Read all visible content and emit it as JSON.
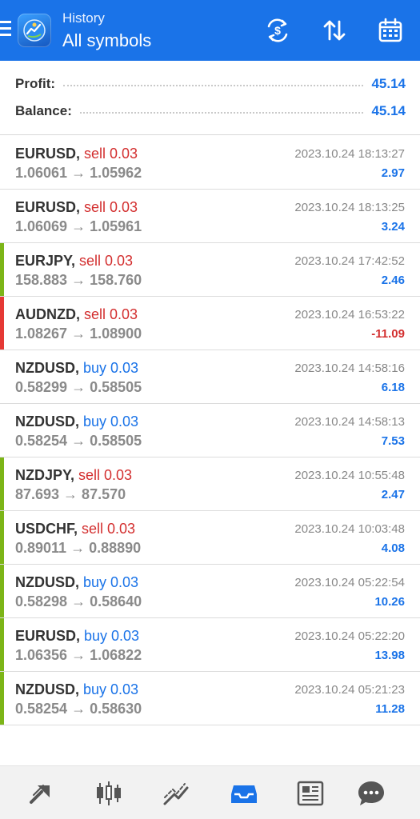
{
  "header": {
    "title_small": "History",
    "title_big": "All symbols",
    "icons": [
      "menu-icon",
      "app-logo",
      "currency-exchange-icon",
      "sort-icon",
      "calendar-icon"
    ]
  },
  "summary": {
    "profit_label": "Profit:",
    "profit_value": "45.14",
    "balance_label": "Balance:",
    "balance_value": "45.14"
  },
  "deals": [
    {
      "symbol": "EURUSD,",
      "side": "sell 0.03",
      "type": "sell",
      "prices": "1.06061 → 1.05962",
      "time": "2023.10.24 18:13:27",
      "profit": "2.97",
      "bar": ""
    },
    {
      "symbol": "EURUSD,",
      "side": "sell 0.03",
      "type": "sell",
      "prices": "1.06069 → 1.05961",
      "time": "2023.10.24 18:13:25",
      "profit": "3.24",
      "bar": ""
    },
    {
      "symbol": "EURJPY,",
      "side": "sell 0.03",
      "type": "sell",
      "prices": "158.883 → 158.760",
      "time": "2023.10.24 17:42:52",
      "profit": "2.46",
      "bar": "#7cb518"
    },
    {
      "symbol": "AUDNZD,",
      "side": "sell 0.03",
      "type": "sell",
      "prices": "1.08267 → 1.08900",
      "time": "2023.10.24 16:53:22",
      "profit": "-11.09",
      "bar": "#e53935"
    },
    {
      "symbol": "NZDUSD,",
      "side": "buy 0.03",
      "type": "buy",
      "prices": "0.58299 → 0.58505",
      "time": "2023.10.24 14:58:16",
      "profit": "6.18",
      "bar": ""
    },
    {
      "symbol": "NZDUSD,",
      "side": "buy 0.03",
      "type": "buy",
      "prices": "0.58254 → 0.58505",
      "time": "2023.10.24 14:58:13",
      "profit": "7.53",
      "bar": ""
    },
    {
      "symbol": "NZDJPY,",
      "side": "sell 0.03",
      "type": "sell",
      "prices": "87.693 → 87.570",
      "time": "2023.10.24 10:55:48",
      "profit": "2.47",
      "bar": "#7cb518"
    },
    {
      "symbol": "USDCHF,",
      "side": "sell 0.03",
      "type": "sell",
      "prices": "0.89011 → 0.88890",
      "time": "2023.10.24 10:03:48",
      "profit": "4.08",
      "bar": "#7cb518"
    },
    {
      "symbol": "NZDUSD,",
      "side": "buy 0.03",
      "type": "buy",
      "prices": "0.58298 → 0.58640",
      "time": "2023.10.24 05:22:54",
      "profit": "10.26",
      "bar": "#7cb518"
    },
    {
      "symbol": "EURUSD,",
      "side": "buy 0.03",
      "type": "buy",
      "prices": "1.06356 → 1.06822",
      "time": "2023.10.24 05:22:20",
      "profit": "13.98",
      "bar": "#7cb518"
    },
    {
      "symbol": "NZDUSD,",
      "side": "buy 0.03",
      "type": "buy",
      "prices": "0.58254 → 0.58630",
      "time": "2023.10.24 05:21:23",
      "profit": "11.28",
      "bar": "#7cb518"
    }
  ],
  "bottom_nav": {
    "items": [
      "quotes-icon",
      "chart-icon",
      "trade-icon",
      "history-icon",
      "news-icon",
      "messages-icon"
    ],
    "active": "history-icon"
  },
  "colors": {
    "accent": "#1a73e8",
    "sell": "#d32f2f",
    "buy": "#1a73e8",
    "profit_bar": "#7cb518",
    "loss_bar": "#e53935",
    "nav_inactive": "#555555"
  }
}
